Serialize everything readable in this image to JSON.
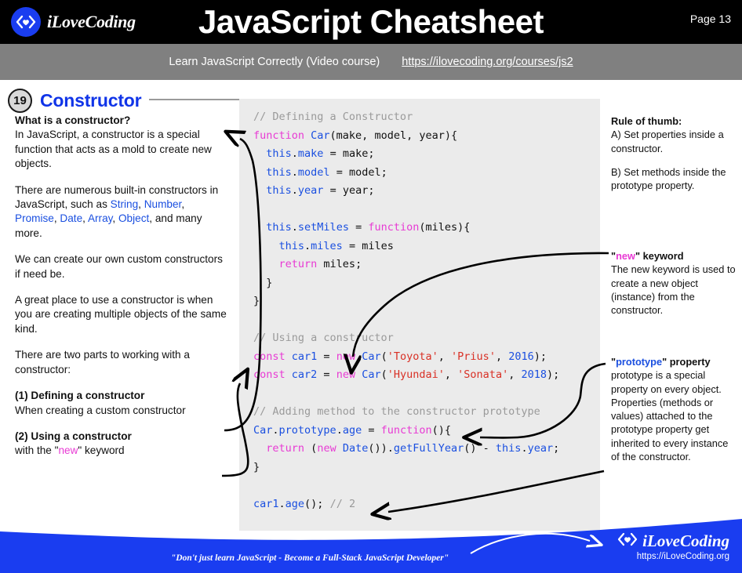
{
  "header": {
    "brand": "iLoveCoding",
    "title": "JavaScript Cheatsheet",
    "page_label": "Page 13",
    "logo_icon": "code-heart-icon",
    "bg_color": "#000000"
  },
  "subheader": {
    "text": "Learn JavaScript Correctly (Video course)",
    "link": "https://ilovecoding.org/courses/js2",
    "bg_color": "#808080"
  },
  "section": {
    "number": "19",
    "title": "Constructor",
    "title_color": "#1034e8"
  },
  "left_column": {
    "heading": "What is a constructor?",
    "p1": "In JavaScript, a constructor is a special function that acts as a mold to create new objects.",
    "p2_prefix": "There are numerous built-in constructors in JavaScript, such as ",
    "p2_builtins": [
      "String",
      "Number",
      "Promise",
      "Date",
      "Array",
      "Object"
    ],
    "p2_suffix": ", and many more.",
    "p3": "We can create our own custom constructors if need be.",
    "p4": "A great place to use a constructor is when you are creating multiple objects of the same kind.",
    "p5": "There are two parts to working with a constructor:",
    "part1_title": "(1) Defining a constructor",
    "part1_body": "When creating a custom constructor",
    "part2_title": "(2) Using a constructor",
    "part2_body_prefix": "with the \"",
    "part2_body_keyword": "new",
    "part2_body_suffix": "\" keyword"
  },
  "code": {
    "bg_color": "#ebebeb",
    "lines": [
      [
        {
          "t": "// Defining a Constructor",
          "c": "com"
        }
      ],
      [
        {
          "t": "function ",
          "c": "key"
        },
        {
          "t": "Car",
          "c": "fn"
        },
        {
          "t": "(make, model, year){",
          "c": "plain"
        }
      ],
      [
        {
          "t": "  ",
          "c": "plain"
        },
        {
          "t": "this",
          "c": "fn"
        },
        {
          "t": ".",
          "c": "plain"
        },
        {
          "t": "make",
          "c": "prop"
        },
        {
          "t": " = make;",
          "c": "plain"
        }
      ],
      [
        {
          "t": "  ",
          "c": "plain"
        },
        {
          "t": "this",
          "c": "fn"
        },
        {
          "t": ".",
          "c": "plain"
        },
        {
          "t": "model",
          "c": "prop"
        },
        {
          "t": " = model;",
          "c": "plain"
        }
      ],
      [
        {
          "t": "  ",
          "c": "plain"
        },
        {
          "t": "this",
          "c": "fn"
        },
        {
          "t": ".",
          "c": "plain"
        },
        {
          "t": "year",
          "c": "prop"
        },
        {
          "t": " = year;",
          "c": "plain"
        }
      ],
      [
        {
          "t": "",
          "c": "plain"
        }
      ],
      [
        {
          "t": "  ",
          "c": "plain"
        },
        {
          "t": "this",
          "c": "fn"
        },
        {
          "t": ".",
          "c": "plain"
        },
        {
          "t": "setMiles",
          "c": "prop"
        },
        {
          "t": " = ",
          "c": "plain"
        },
        {
          "t": "function",
          "c": "key"
        },
        {
          "t": "(miles){",
          "c": "plain"
        }
      ],
      [
        {
          "t": "    ",
          "c": "plain"
        },
        {
          "t": "this",
          "c": "fn"
        },
        {
          "t": ".",
          "c": "plain"
        },
        {
          "t": "miles",
          "c": "prop"
        },
        {
          "t": " = miles",
          "c": "plain"
        }
      ],
      [
        {
          "t": "    ",
          "c": "plain"
        },
        {
          "t": "return",
          "c": "key"
        },
        {
          "t": " miles;",
          "c": "plain"
        }
      ],
      [
        {
          "t": "  }",
          "c": "plain"
        }
      ],
      [
        {
          "t": "}",
          "c": "plain"
        }
      ],
      [
        {
          "t": "",
          "c": "plain"
        }
      ],
      [
        {
          "t": "// Using a constructor",
          "c": "com"
        }
      ],
      [
        {
          "t": "const",
          "c": "key"
        },
        {
          "t": " ",
          "c": "plain"
        },
        {
          "t": "car1",
          "c": "fn"
        },
        {
          "t": " = ",
          "c": "plain"
        },
        {
          "t": "new",
          "c": "key"
        },
        {
          "t": " ",
          "c": "plain"
        },
        {
          "t": "Car",
          "c": "fn"
        },
        {
          "t": "(",
          "c": "plain"
        },
        {
          "t": "'Toyota'",
          "c": "str"
        },
        {
          "t": ", ",
          "c": "plain"
        },
        {
          "t": "'Prius'",
          "c": "str"
        },
        {
          "t": ", ",
          "c": "plain"
        },
        {
          "t": "2016",
          "c": "num"
        },
        {
          "t": ");",
          "c": "plain"
        }
      ],
      [
        {
          "t": "const",
          "c": "key"
        },
        {
          "t": " ",
          "c": "plain"
        },
        {
          "t": "car2",
          "c": "fn"
        },
        {
          "t": " = ",
          "c": "plain"
        },
        {
          "t": "new",
          "c": "key"
        },
        {
          "t": " ",
          "c": "plain"
        },
        {
          "t": "Car",
          "c": "fn"
        },
        {
          "t": "(",
          "c": "plain"
        },
        {
          "t": "'Hyundai'",
          "c": "str"
        },
        {
          "t": ", ",
          "c": "plain"
        },
        {
          "t": "'Sonata'",
          "c": "str"
        },
        {
          "t": ", ",
          "c": "plain"
        },
        {
          "t": "2018",
          "c": "num"
        },
        {
          "t": ");",
          "c": "plain"
        }
      ],
      [
        {
          "t": "",
          "c": "plain"
        }
      ],
      [
        {
          "t": "// Adding method to the constructor prototype",
          "c": "com"
        }
      ],
      [
        {
          "t": "Car",
          "c": "fn"
        },
        {
          "t": ".",
          "c": "plain"
        },
        {
          "t": "prototype",
          "c": "prop"
        },
        {
          "t": ".",
          "c": "plain"
        },
        {
          "t": "age",
          "c": "prop"
        },
        {
          "t": " = ",
          "c": "plain"
        },
        {
          "t": "function",
          "c": "key"
        },
        {
          "t": "(){",
          "c": "plain"
        }
      ],
      [
        {
          "t": "  ",
          "c": "plain"
        },
        {
          "t": "return",
          "c": "key"
        },
        {
          "t": " (",
          "c": "plain"
        },
        {
          "t": "new",
          "c": "key"
        },
        {
          "t": " ",
          "c": "plain"
        },
        {
          "t": "Date",
          "c": "fn"
        },
        {
          "t": "()).",
          "c": "plain"
        },
        {
          "t": "getFullYear",
          "c": "prop"
        },
        {
          "t": "() - ",
          "c": "plain"
        },
        {
          "t": "this",
          "c": "fn"
        },
        {
          "t": ".",
          "c": "plain"
        },
        {
          "t": "year",
          "c": "prop"
        },
        {
          "t": ";",
          "c": "plain"
        }
      ],
      [
        {
          "t": "}",
          "c": "plain"
        }
      ],
      [
        {
          "t": "",
          "c": "plain"
        }
      ],
      [
        {
          "t": "car1",
          "c": "fn"
        },
        {
          "t": ".",
          "c": "plain"
        },
        {
          "t": "age",
          "c": "prop"
        },
        {
          "t": "(); ",
          "c": "plain"
        },
        {
          "t": "// 2",
          "c": "com"
        }
      ]
    ]
  },
  "right_column": {
    "rule_title": "Rule of thumb:",
    "rule_a": "A) Set properties inside a constructor.",
    "rule_b": "B) Set methods inside the prototype property.",
    "new_title_open": "\"",
    "new_title_keyword": "new",
    "new_title_close": "\" keyword",
    "new_body": "The new keyword is used to create a new object (instance) from the constructor.",
    "proto_title_open": "\"",
    "proto_title_keyword": "prototype",
    "proto_title_close": "\" property",
    "proto_body": "prototype is a special property on every object. Properties (methods or values) attached to the prototype property get inherited to every instance of the constructor."
  },
  "footer": {
    "tagline": "\"Don't just learn JavaScript - Become a Full-Stack JavaScript Developer\"",
    "brand": "iLoveCoding",
    "url": "https://iLoveCoding.org",
    "bg_color": "#1a3df0"
  }
}
